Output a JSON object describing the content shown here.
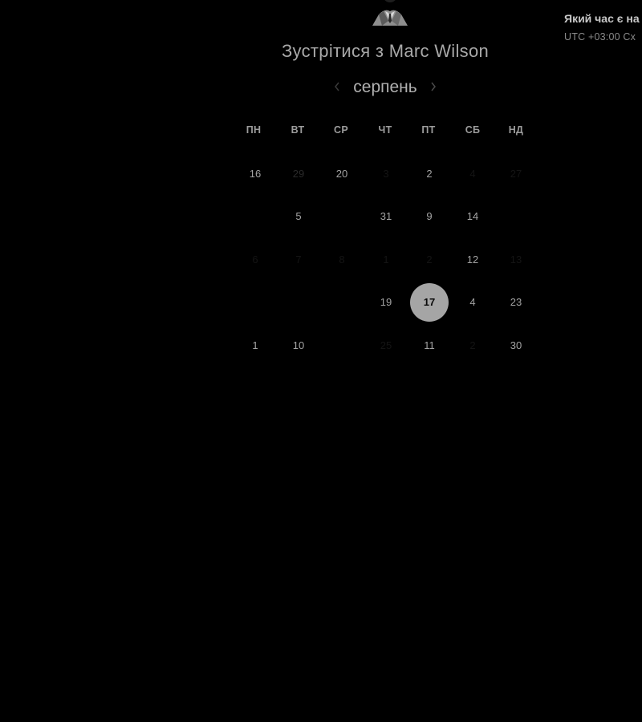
{
  "booking": {
    "title": "Зустрітися з Marc Wilson"
  },
  "timezone": {
    "question": "Який час є на",
    "value": "UTC +03:00 Сх"
  },
  "calendar": {
    "month": "серпень",
    "weekdays": [
      "ПН",
      "ВТ",
      "СР",
      "ЧТ",
      "ПТ",
      "СБ",
      "НД"
    ],
    "selected_day": "17",
    "rows": [
      [
        {
          "label": "16",
          "state": "on"
        },
        {
          "label": "29",
          "state": "dim"
        },
        {
          "label": "20",
          "state": "on"
        },
        {
          "label": "3",
          "state": "faint"
        },
        {
          "label": "2",
          "state": "on"
        },
        {
          "label": "4",
          "state": "faint"
        },
        {
          "label": "27",
          "state": "faint"
        }
      ],
      [
        {
          "label": "",
          "state": "faint"
        },
        {
          "label": "5",
          "state": "on"
        },
        {
          "label": "",
          "state": "faint"
        },
        {
          "label": "31",
          "state": "on"
        },
        {
          "label": "9",
          "state": "on"
        },
        {
          "label": "14",
          "state": "on"
        },
        {
          "label": "",
          "state": "faint"
        }
      ],
      [
        {
          "label": "6",
          "state": "faint"
        },
        {
          "label": "7",
          "state": "faint"
        },
        {
          "label": "8",
          "state": "faint"
        },
        {
          "label": "1",
          "state": "faint"
        },
        {
          "label": "2",
          "state": "faint"
        },
        {
          "label": "12",
          "state": "on"
        },
        {
          "label": "13",
          "state": "faint"
        }
      ],
      [
        {
          "label": "",
          "state": "faint"
        },
        {
          "label": "",
          "state": "faint"
        },
        {
          "label": "",
          "state": "faint"
        },
        {
          "label": "19",
          "state": "on"
        },
        {
          "label": "17",
          "state": "selected"
        },
        {
          "label": "4",
          "state": "on"
        },
        {
          "label": "23",
          "state": "on"
        }
      ],
      [
        {
          "label": "1",
          "state": "on"
        },
        {
          "label": "10",
          "state": "on"
        },
        {
          "label": "",
          "state": "faint"
        },
        {
          "label": "25",
          "state": "faint"
        },
        {
          "label": "11",
          "state": "on"
        },
        {
          "label": "2",
          "state": "faint"
        },
        {
          "label": "30",
          "state": "on"
        }
      ]
    ]
  },
  "icons": {
    "avatar": "avatar-photo",
    "prev": "chevron-left-icon",
    "next": "chevron-right-icon"
  },
  "colors": {
    "background": "#000000",
    "selected_day_bg": "#a5a5a5",
    "text_primary": "#a3a3a3"
  }
}
